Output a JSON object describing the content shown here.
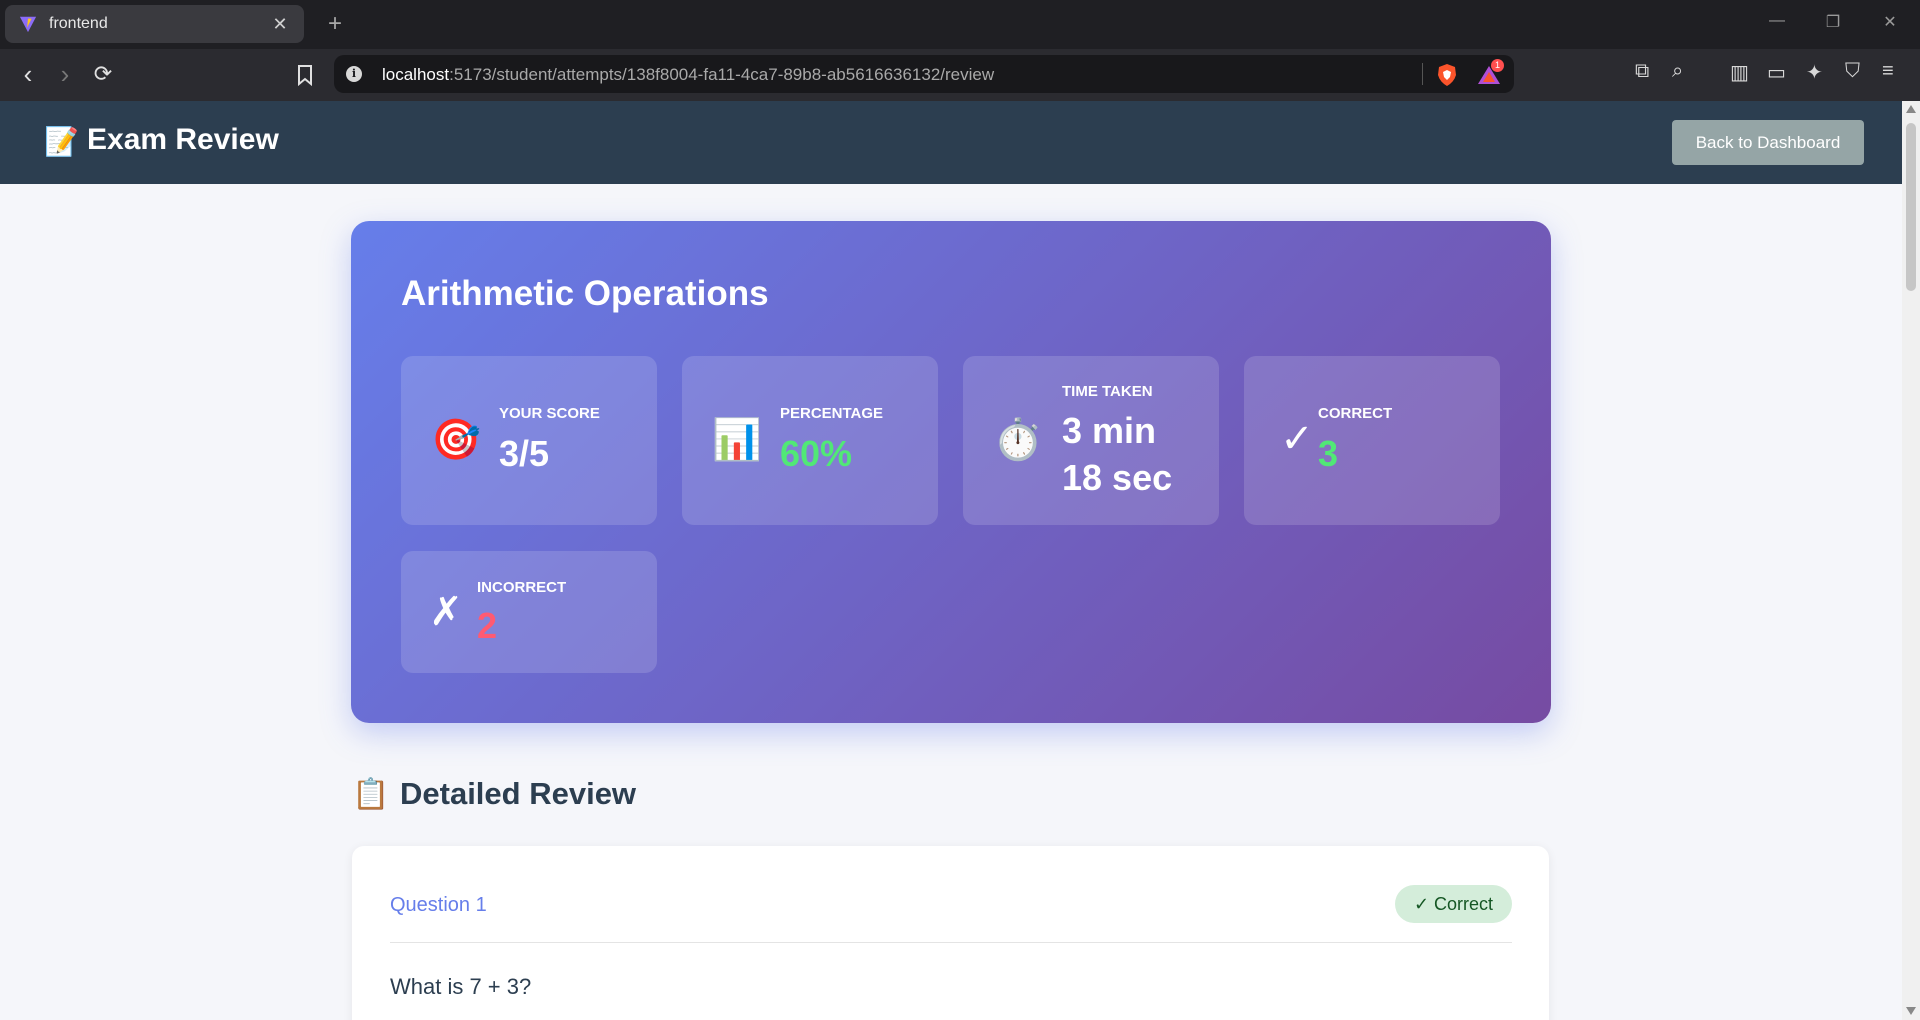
{
  "browser": {
    "tab_title": "frontend",
    "url_host": "localhost",
    "url_path": ":5173/student/attempts/138f8004-fa11-4ca7-89b8-ab5616636132/review",
    "notification_count": "1"
  },
  "header": {
    "icon": "📝",
    "title": "Exam Review",
    "back_label": "Back to Dashboard"
  },
  "summary": {
    "exam_title": "Arithmetic Operations",
    "stats": [
      {
        "icon": "🎯",
        "label": "Your Score",
        "value": "3/5"
      },
      {
        "icon": "📊",
        "label": "Percentage",
        "value": "60%"
      },
      {
        "icon": "⏱️",
        "label": "Time Taken",
        "value_line1": "3 min",
        "value_line2": "18 sec"
      },
      {
        "icon": "✓",
        "label": "Correct",
        "value": "3"
      },
      {
        "icon": "✗",
        "label": "Incorrect",
        "value": "2"
      }
    ]
  },
  "review": {
    "icon": "📋",
    "title": "Detailed Review",
    "questions": [
      {
        "number_label": "Question 1",
        "status": "✓ Correct",
        "text": "What is 7 + 3?"
      }
    ]
  },
  "colors": {
    "header_bg": "#2c3e50",
    "gradient_start": "#667eea",
    "gradient_end": "#764ba2",
    "correct_green": "#51e876",
    "incorrect_red": "#ff5a72"
  }
}
